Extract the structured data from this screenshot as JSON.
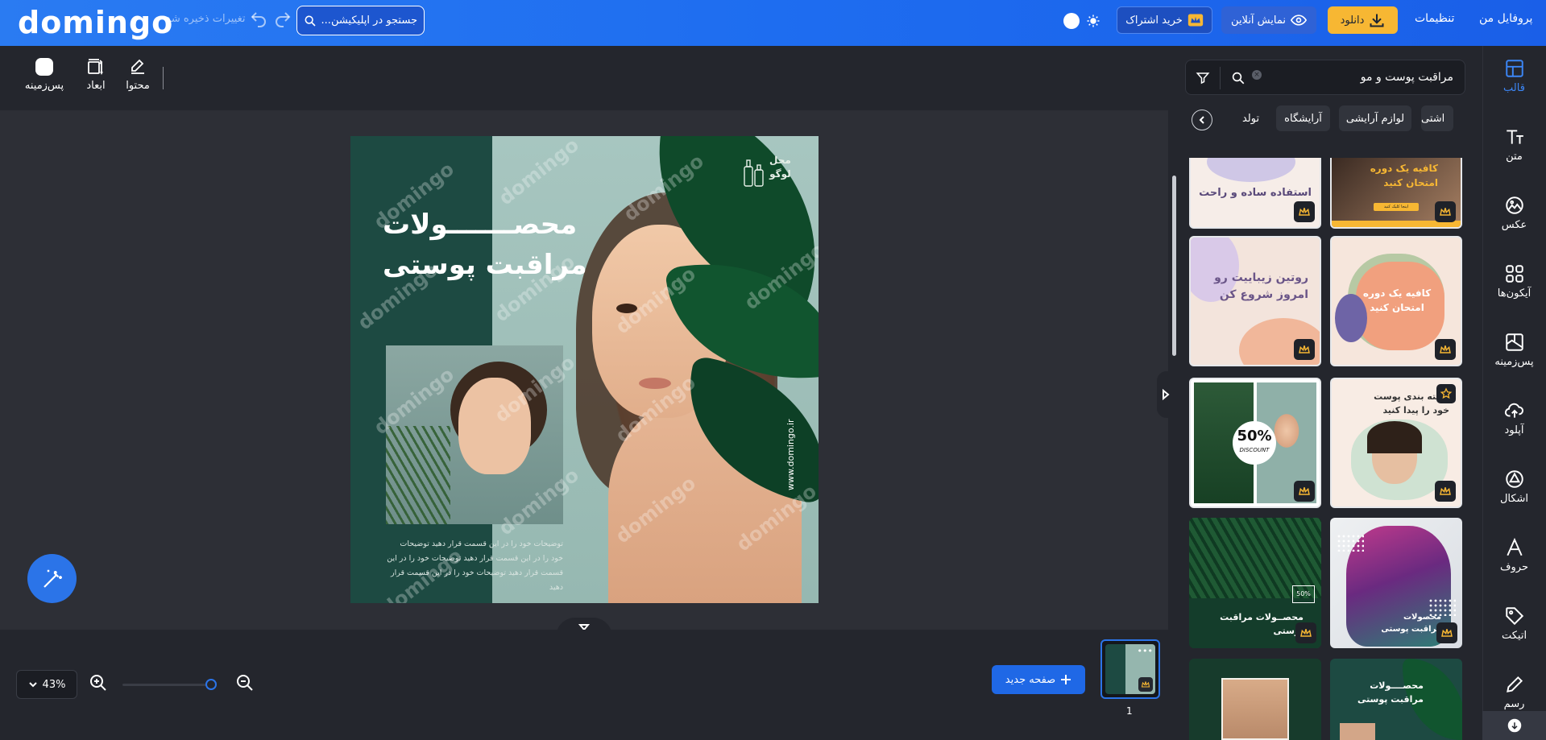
{
  "header": {
    "logo": "domingo",
    "save_state": "تغییرات ذخیره شد",
    "search_placeholder": "جستجو در اپلیکیشن...",
    "subscribe_label": "خرید اشتراک",
    "online_label": "نمایش آنلاین",
    "download_label": "دانلود",
    "settings_label": "تنظیمات",
    "profile_label": "پروفایل من"
  },
  "toolbar": {
    "content_label": "محتوا",
    "dimensions_label": "ابعاد",
    "background_label": "پس‌زمینه"
  },
  "design": {
    "logo_placeholder_line1": "محل",
    "logo_placeholder_line2": "لوگو",
    "title_line1": "محصـــــــولات",
    "title_line2": "مراقبت پوستی",
    "description": "توضیحات خود را در این قسمت قرار دهید توضیحات خود را در این قسمت قرار دهید توضیحات خود را در این قسمت قرار دهید توضیحات خود را در این قسمت قرار دهید",
    "url": "www.domingo.ir",
    "watermark": "domingo"
  },
  "bottom": {
    "zoom_value": "43%",
    "zoom_level": 0.43,
    "new_page_label": "صفحه جدید",
    "page_number": "1"
  },
  "right_panel": {
    "search_value": "مراقبت پوست و مو",
    "chips": [
      "اشتی",
      "لوازم آرایشی",
      "آرایشگاه",
      "تولد"
    ],
    "cards": [
      {
        "title": "استفاده ساده و راحت"
      },
      {
        "title": "کافیه یک دوره امتحان کنید",
        "button": "اینجا کلیک کنید"
      },
      {
        "title": "روتین زیباییت رو امروز شروع کن"
      },
      {
        "title": "کافیه یک دوره امتحان کنید"
      },
      {
        "title": "",
        "badge": "50%",
        "badge_sub": "DISCOUNT"
      },
      {
        "title": "دسته بندی پوست خود را پیدا کنید"
      },
      {
        "title": "محصــولات مراقبت پوستی",
        "badge": "50%"
      },
      {
        "title": "محصولات مراقبت پوستی"
      },
      {
        "title": ""
      },
      {
        "title": "محصــــولات مراقبت پوستی"
      }
    ]
  },
  "sidenav": {
    "items": [
      "قالب",
      "متن",
      "عکس",
      "آیکون‌ها",
      "پس‌زمینه",
      "آپلود",
      "اشکال",
      "حروف",
      "اتیکت",
      "رسم"
    ]
  },
  "colors": {
    "brand_blue": "#1e6df0",
    "download_yellow": "#f7b733",
    "panel_dark": "#24262d",
    "canvas_bg": "#2d2f36",
    "design_green": "#1d4a42"
  }
}
